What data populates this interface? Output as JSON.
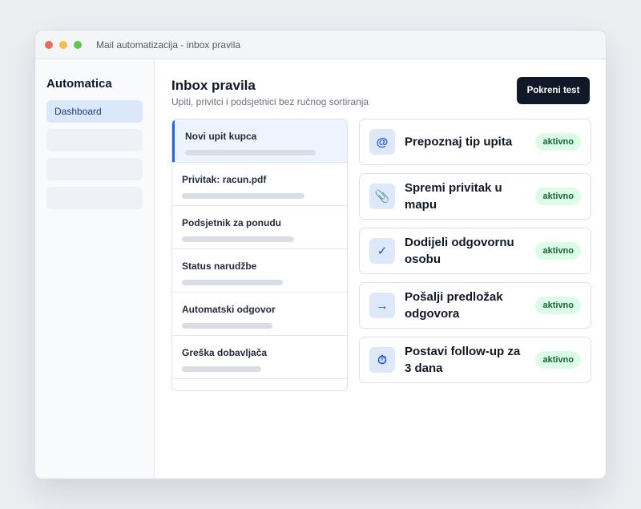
{
  "window": {
    "title": "Mail automatizacija - inbox pravila"
  },
  "sidebar": {
    "brand": "Automatica",
    "items": [
      {
        "label": "Dashboard",
        "active": true
      },
      {
        "label": ""
      },
      {
        "label": ""
      },
      {
        "label": ""
      }
    ]
  },
  "header": {
    "title": "Inbox pravila",
    "subtitle": "Upiti, privitci i podsjetnici bez ručnog sortiranja",
    "action_label": "Pokreni test"
  },
  "emails": [
    {
      "title": "Novi upit kupca",
      "selected": true
    },
    {
      "title": "Privitak: racun.pdf"
    },
    {
      "title": "Podsjetnik za ponudu"
    },
    {
      "title": "Status narudžbe"
    },
    {
      "title": "Automatski odgovor"
    },
    {
      "title": "Greška dobavljača"
    }
  ],
  "rules": [
    {
      "icon": "at-icon",
      "glyph": "@",
      "label": "Prepoznaj tip upita",
      "status": "aktivno"
    },
    {
      "icon": "paperclip-icon",
      "glyph": "📎",
      "label": "Spremi privitak u mapu",
      "status": "aktivno"
    },
    {
      "icon": "checkmark-icon",
      "glyph": "✓",
      "label": "Dodijeli odgovornu osobu",
      "status": "aktivno"
    },
    {
      "icon": "arrow-right-icon",
      "glyph": "→",
      "label": "Pošalji predložak odgovora",
      "status": "aktivno"
    },
    {
      "icon": "stopwatch-icon",
      "glyph": "⏱",
      "label": "Postavi follow-up za 3 dana",
      "status": "aktivno"
    }
  ],
  "colors": {
    "accent": "#2563eb",
    "primary_button": "#111827",
    "badge_bg": "#dcfce7",
    "badge_text": "#166534"
  }
}
